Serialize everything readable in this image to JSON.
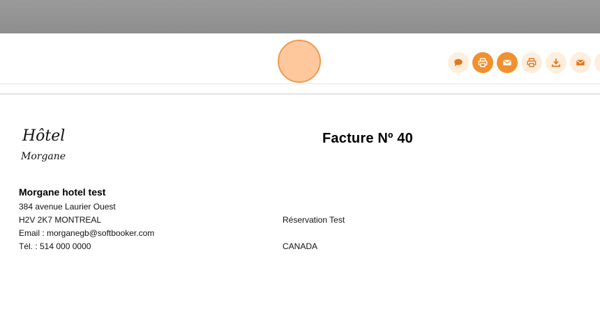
{
  "toolbar": {
    "actions": [
      {
        "icon": "comment-icon",
        "style": "light"
      },
      {
        "icon": "print-icon",
        "style": "solid"
      },
      {
        "icon": "envelope-icon",
        "style": "solid"
      },
      {
        "icon": "print-icon",
        "style": "light"
      },
      {
        "icon": "download-icon",
        "style": "light"
      },
      {
        "icon": "envelope-icon",
        "style": "light"
      },
      {
        "icon": "more-icon",
        "style": "light"
      }
    ],
    "accent_color": "#f0902e",
    "accent_light_color": "#fdeedd"
  },
  "logo": {
    "line1": "Hôtel",
    "line2": "Morgane"
  },
  "invoice": {
    "title": "Facture Nº 40"
  },
  "hotel": {
    "name": "Morgane hotel test",
    "address": "384 avenue Laurier Ouest",
    "postal_city": "H2V 2K7 MONTREAL",
    "email": "Email : morganegb@softbooker.com",
    "phone": "Tél. : 514 000 0000"
  },
  "client": {
    "name": "Réservation Test",
    "country": "CANADA"
  }
}
